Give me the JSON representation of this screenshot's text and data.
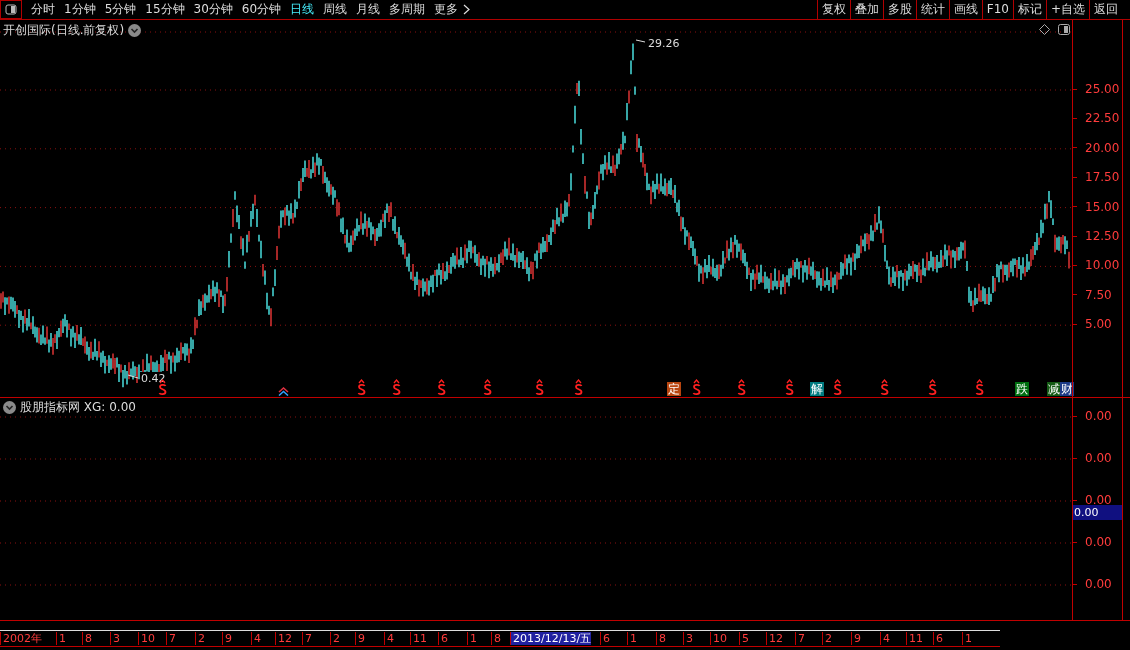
{
  "toolbar": {
    "period_tabs": [
      {
        "label": "分时",
        "selected": false
      },
      {
        "label": "1分钟",
        "selected": false
      },
      {
        "label": "5分钟",
        "selected": false
      },
      {
        "label": "15分钟",
        "selected": false
      },
      {
        "label": "30分钟",
        "selected": false
      },
      {
        "label": "60分钟",
        "selected": false
      },
      {
        "label": "日线",
        "selected": true
      },
      {
        "label": "周线",
        "selected": false
      },
      {
        "label": "月线",
        "selected": false
      },
      {
        "label": "多周期",
        "selected": false
      },
      {
        "label": "更多",
        "selected": false
      }
    ],
    "buttons": [
      "复权",
      "叠加",
      "多股",
      "统计",
      "画线",
      "F10",
      "标记",
      "+自选",
      "返回"
    ]
  },
  "main_chart": {
    "title": "开创国际(日线.前复权)",
    "high_label": "29.26",
    "low_label": "0.42",
    "price_axis": [
      "25.00",
      "22.50",
      "20.00",
      "17.50",
      "15.00",
      "12.50",
      "10.00",
      "7.50",
      "5.00"
    ],
    "signals": [
      {
        "kind": "sell"
      },
      {
        "kind": "buy"
      },
      {
        "kind": "sell"
      },
      {
        "kind": "sell"
      },
      {
        "kind": "sell"
      },
      {
        "kind": "sell"
      },
      {
        "kind": "sell"
      },
      {
        "kind": "sell"
      },
      {
        "kind": "tag",
        "text": "定",
        "color": "#b8450f"
      },
      {
        "kind": "sell"
      },
      {
        "kind": "sell"
      },
      {
        "kind": "sell"
      },
      {
        "kind": "tag",
        "text": "解",
        "color": "#007b80"
      },
      {
        "kind": "sell"
      },
      {
        "kind": "sell"
      },
      {
        "kind": "sell"
      },
      {
        "kind": "sell"
      },
      {
        "kind": "tag",
        "text": "跌",
        "color": "#006e10"
      },
      {
        "kind": "tag",
        "text": "减",
        "color": "#145a14"
      },
      {
        "kind": "tag",
        "text": "财",
        "color": "#1c3a86"
      }
    ]
  },
  "indicator_panel": {
    "title": "股朋指标网 XG: 0.00",
    "axis": [
      "0.00",
      "0.00",
      "0.00",
      "0.00",
      "0.00"
    ],
    "current_value": "0.00"
  },
  "date_axis": {
    "labels": [
      {
        "kind": "tick",
        "text": "2002年"
      },
      {
        "kind": "tick",
        "text": "1"
      },
      {
        "kind": "tick",
        "text": "8"
      },
      {
        "kind": "tick",
        "text": "3"
      },
      {
        "kind": "tick",
        "text": "10"
      },
      {
        "kind": "tick",
        "text": "7"
      },
      {
        "kind": "tick",
        "text": "2"
      },
      {
        "kind": "tick",
        "text": "9"
      },
      {
        "kind": "tick",
        "text": "4"
      },
      {
        "kind": "tick",
        "text": "12"
      },
      {
        "kind": "tick",
        "text": "7"
      },
      {
        "kind": "tick",
        "text": "2"
      },
      {
        "kind": "tick",
        "text": "9"
      },
      {
        "kind": "tick",
        "text": "4"
      },
      {
        "kind": "tick",
        "text": "11"
      },
      {
        "kind": "tick",
        "text": "6"
      },
      {
        "kind": "tick",
        "text": "1"
      },
      {
        "kind": "tick",
        "text": "8"
      },
      {
        "kind": "cursor",
        "text": "2013/12/13/五"
      },
      {
        "kind": "tick",
        "text": "6"
      },
      {
        "kind": "tick",
        "text": "1"
      },
      {
        "kind": "tick",
        "text": "8"
      },
      {
        "kind": "tick",
        "text": "3"
      },
      {
        "kind": "tick",
        "text": "10"
      },
      {
        "kind": "tick",
        "text": "5"
      },
      {
        "kind": "tick",
        "text": "12"
      },
      {
        "kind": "tick",
        "text": "7"
      },
      {
        "kind": "tick",
        "text": "2"
      },
      {
        "kind": "tick",
        "text": "9"
      },
      {
        "kind": "tick",
        "text": "4"
      },
      {
        "kind": "tick",
        "text": "11"
      },
      {
        "kind": "tick",
        "text": "6"
      },
      {
        "kind": "tick",
        "text": "1"
      }
    ]
  }
}
